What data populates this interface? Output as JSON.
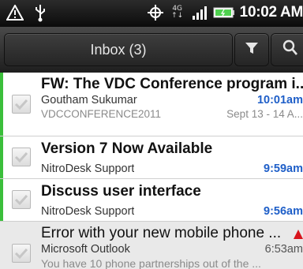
{
  "status_bar": {
    "time": "10:02 AM",
    "network": "4G",
    "icons": [
      "alert-icon",
      "usb-icon",
      "gps-icon",
      "network-4g-icon",
      "signal-icon",
      "battery-icon"
    ]
  },
  "toolbar": {
    "folder_label": "Inbox (3)",
    "filter_icon": "filter-icon",
    "search_icon": "search-icon"
  },
  "colors": {
    "unread_bar": "#3bbf3b",
    "time_blue": "#1f5fc8",
    "warning_red": "#d8141c"
  },
  "emails": [
    {
      "subject": "FW: The VDC Conference program i...",
      "sender": "Goutham Sukumar",
      "time": "10:01am",
      "preview_left": "VDCCONFERENCE2011",
      "preview_right": "Sept 13 - 14  A...",
      "unread": true
    },
    {
      "subject": "Version 7 Now Available",
      "sender": "NitroDesk Support",
      "time": "9:59am",
      "unread": true
    },
    {
      "subject": "Discuss user interface",
      "sender": "NitroDesk Support",
      "time": "9:56am",
      "unread": true
    },
    {
      "subject": "Error with your new mobile phone ...",
      "sender": "Microsoft Outlook",
      "time": "6:53am",
      "preview_left": "You have 10 phone partnerships out of the ...",
      "unread": false,
      "important_icon": "warning-triangle-icon"
    }
  ]
}
